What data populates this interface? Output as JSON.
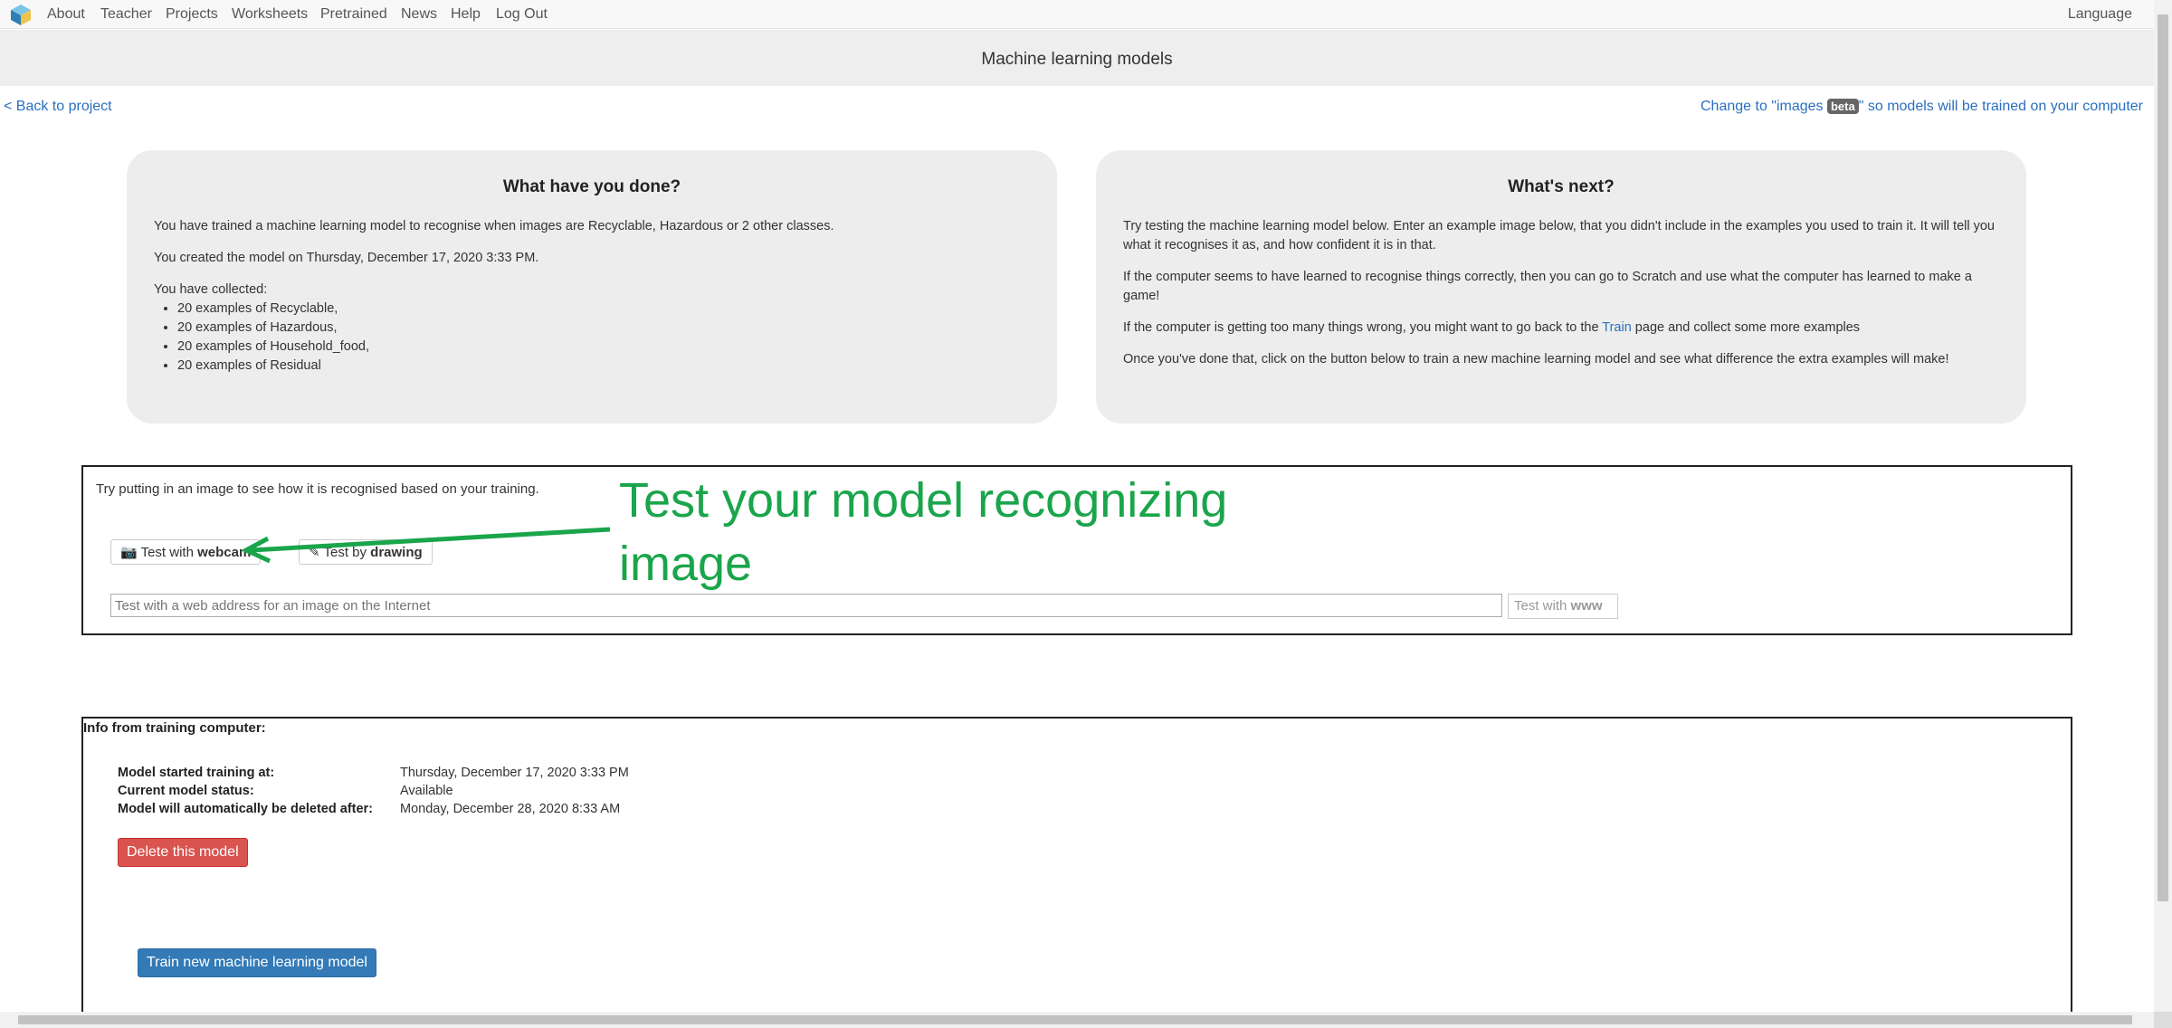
{
  "nav": {
    "items": [
      "About",
      "Teacher",
      "Projects",
      "Worksheets",
      "Pretrained",
      "News",
      "Help",
      "Log Out"
    ],
    "language": "Language"
  },
  "page_title": "Machine learning models",
  "back_link": "< Back to project",
  "change_link": {
    "before": "Change to \"images ",
    "badge": "beta",
    "after": "\" so models will be trained on your computer"
  },
  "done_panel": {
    "title": "What have you done?",
    "line1": "You have trained a machine learning model to recognise when images are Recyclable, Hazardous or 2 other classes.",
    "line2": "You created the model on Thursday, December 17, 2020 3:33 PM.",
    "collected_label": "You have collected:",
    "collected": [
      "20 examples of Recyclable,",
      "20 examples of Hazardous,",
      "20 examples of Household_food,",
      "20 examples of Residual"
    ]
  },
  "next_panel": {
    "title": "What's next?",
    "p1": "Try testing the machine learning model below. Enter an example image below, that you didn't include in the examples you used to train it. It will tell you what it recognises it as, and how confident it is in that.",
    "p2": "If the computer seems to have learned to recognise things correctly, then you can go to Scratch and use what the computer has learned to make a game!",
    "p3_before": "If the computer is getting too many things wrong, you might want to go back to the ",
    "p3_link": "Train",
    "p3_after": " page and collect some more examples",
    "p4": "Once you've done that, click on the button below to train a new machine learning model and see what difference the extra examples will make!"
  },
  "test": {
    "intro": "Try putting in an image to see how it is recognised based on your training.",
    "webcam_prefix": "Test with ",
    "webcam_bold": "webcam",
    "drawing_prefix": "Test by ",
    "drawing_bold": "drawing",
    "url_placeholder": "Test with a web address for an image on the Internet",
    "www_prefix": "Test with ",
    "www_bold": "www"
  },
  "annotation": {
    "line1": "Test your model recognizing",
    "line2": "image",
    "color": "#1aa54b"
  },
  "info": {
    "heading": "Info from training computer:",
    "rows": [
      {
        "label": "Model started training at:",
        "value": "Thursday, December 17, 2020 3:33 PM"
      },
      {
        "label": "Current model status:",
        "value": "Available"
      },
      {
        "label": "Model will automatically be deleted after:",
        "value": "Monday, December 28, 2020 8:33 AM"
      }
    ],
    "delete_label": "Delete this model",
    "train_label": "Train new machine learning model"
  },
  "colors": {
    "link": "#2a6fc0",
    "danger": "#d9534f",
    "primary": "#337ab7"
  }
}
